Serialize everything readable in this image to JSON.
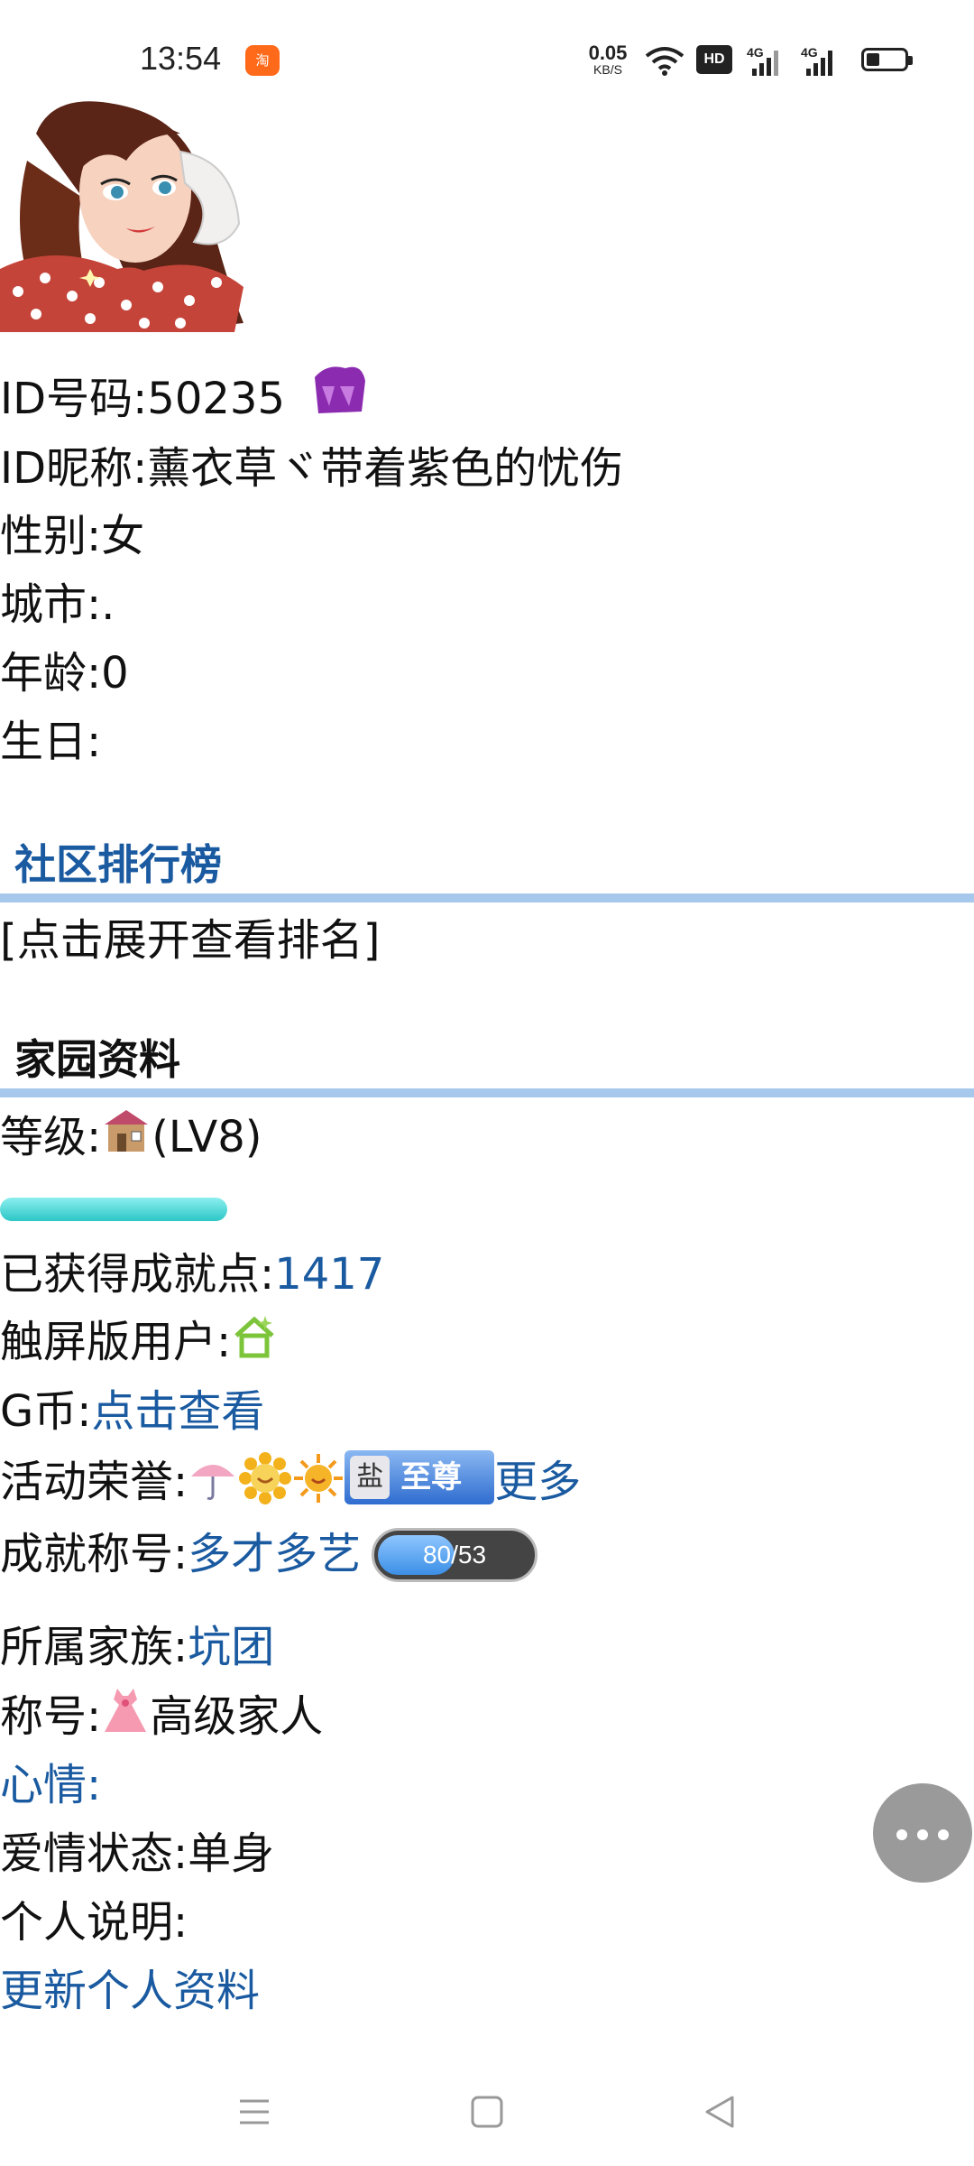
{
  "status_bar": {
    "time": "13:54",
    "app_badge": "淘",
    "net_speed_value": "0.05",
    "net_speed_unit": "KB/S",
    "hd_label": "HD",
    "sig1_label": "4G",
    "sig2_label": "4G",
    "icons": [
      "taobao-icon",
      "wifi-icon",
      "hd-icon",
      "signal-icon",
      "signal-icon",
      "battery-icon"
    ]
  },
  "profile": {
    "id_line": "ID号码:50235",
    "nickname_line": "ID昵称:薰衣草ヾ带着紫色的忧伤",
    "gender_line": "性别:女",
    "city_line": "城市:.",
    "age_line": "年龄:0",
    "birthday_line": "生日:"
  },
  "ranking": {
    "title": "社区排行榜",
    "expand_link": "[点击展开查看排名]"
  },
  "home": {
    "title": "家园资料",
    "level_label": "等级:",
    "level_value": "(LV8)",
    "exp_progress": 1.0,
    "achievement_label": "已获得成就点:",
    "achievement_value": "1417",
    "touch_user_label": "触屏版用户:",
    "gcoin_label": "G币:",
    "gcoin_link": "点击查看",
    "honor_label": "活动荣誉:",
    "honor_badge_text": "至尊",
    "honor_more": "更多",
    "title_label": "成就称号:",
    "title_value": "多才多艺",
    "title_progress_text": "80/53",
    "title_progress_fraction": 0.5,
    "family_label": "所属家族:",
    "family_value": "坑团",
    "rank_label": "称号:",
    "rank_value": "高级家人",
    "mood_label": "心情:",
    "love_label": "爱情状态:单身",
    "desc_label": "个人说明:",
    "update_link": "更新个人资料"
  },
  "colors": {
    "link": "#1a5aa0",
    "section_rule": "#a6c8ec",
    "exp_bar": "#2cc6c6",
    "fab": "#9a9a9a"
  },
  "nav": {
    "icons": [
      "menu-icon",
      "home-square-icon",
      "back-triangle-icon"
    ]
  }
}
